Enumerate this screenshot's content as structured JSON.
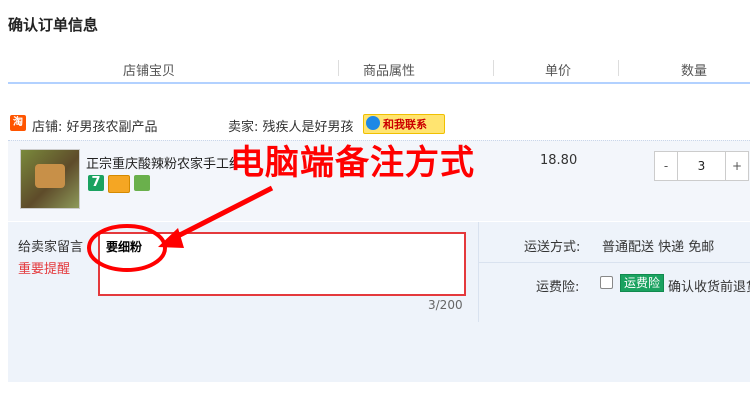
{
  "page": {
    "title": "确认订单信息"
  },
  "table_header": {
    "columns": [
      "店铺宝贝",
      "商品属性",
      "单价",
      "数量"
    ]
  },
  "shop": {
    "icon_text": "淘",
    "shop_label": "店铺: 好男孩农副产品",
    "seller_label": "卖家: 残疾人是好男孩",
    "contact_label": "和我联系"
  },
  "item": {
    "title": "正宗重庆酸辣粉农家手工红薯粉",
    "price": "18.80",
    "quantity": "3",
    "minus_label": "-",
    "plus_label": "+",
    "badge_icons": [
      "seven-day-return-icon",
      "card-icon",
      "quality-icon"
    ],
    "badge_texts": [
      "7"
    ]
  },
  "annotation": {
    "text": "电脑端备注方式"
  },
  "message": {
    "label": "给卖家留言",
    "reminder": "重要提醒",
    "value": "要细粉",
    "counter": "3/200"
  },
  "shipping": {
    "label": "运送方式:",
    "value": "普通配送 快递 免邮",
    "insurance_label": "运费险:",
    "insurance_tag": "运费险",
    "insurance_desc": "确认收货前退货"
  },
  "colors": {
    "accent_red": "#e4393c",
    "annotation_red": "#ff0000",
    "header_border": "#b2d1ff",
    "area_bg": "#eef3fa"
  }
}
